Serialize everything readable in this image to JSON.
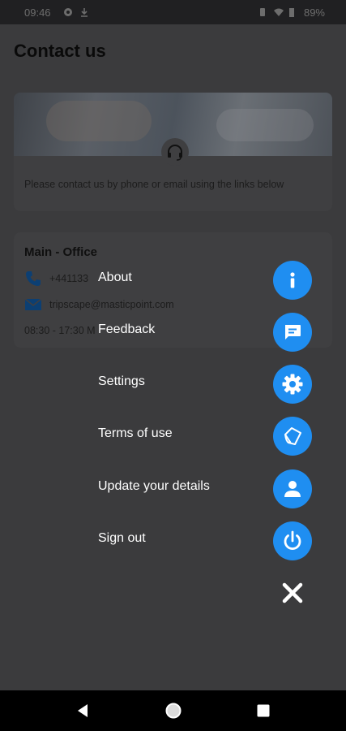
{
  "status_bar": {
    "time": "09:46",
    "battery": "89%",
    "icons": [
      "notification-icon",
      "download-icon",
      "vibrate-icon",
      "wifi-icon",
      "battery-icon"
    ]
  },
  "page": {
    "title": "Contact us",
    "intro_text": "Please contact us by phone or email using the links below",
    "office": {
      "title": "Main - Office",
      "phone": "+441133",
      "email": "tripscape@masticpoint.com",
      "hours": "08:30 - 17:30 M"
    }
  },
  "menu": {
    "items": [
      {
        "label": "About",
        "icon": "info-icon"
      },
      {
        "label": "Feedback",
        "icon": "chat-icon"
      },
      {
        "label": "Settings",
        "icon": "gear-icon"
      },
      {
        "label": "Terms of use",
        "icon": "document-icon"
      },
      {
        "label": "Update your details",
        "icon": "person-icon"
      },
      {
        "label": "Sign out",
        "icon": "power-icon"
      }
    ],
    "close_icon": "close-icon"
  },
  "colors": {
    "accent": "#1f8ef1",
    "overlay_background": "#3b3b3d",
    "menu_text": "#ffffff",
    "navbar": "#000000"
  }
}
